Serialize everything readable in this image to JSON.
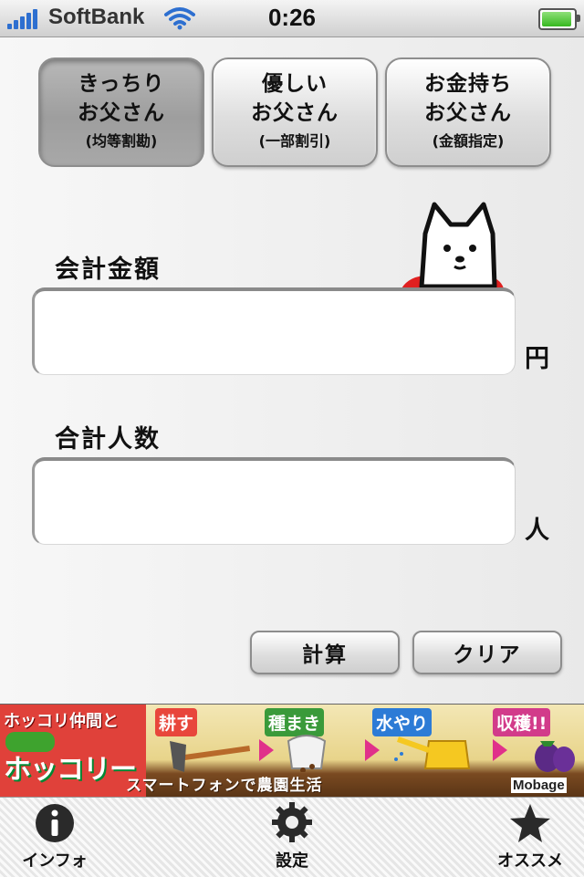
{
  "status_bar": {
    "carrier": "SoftBank",
    "time": "0:26",
    "battery_level": 0.95
  },
  "modes": [
    {
      "line1": "きっちり",
      "line2": "お父さん",
      "sub": "(均等割勘)",
      "selected": true
    },
    {
      "line1": "優しい",
      "line2": "お父さん",
      "sub": "(一部割引)",
      "selected": false
    },
    {
      "line1": "お金持ち",
      "line2": "お父さん",
      "sub": "(金額指定)",
      "selected": false
    }
  ],
  "form": {
    "total_amount_label": "会計金額",
    "total_amount_value": "",
    "total_amount_unit": "円",
    "people_label": "合計人数",
    "people_value": "",
    "people_unit": "人"
  },
  "actions": {
    "calculate": "計算",
    "clear": "クリア"
  },
  "ad": {
    "headline": "ホッコリ仲間と",
    "logo_text": "ホッコリーナ",
    "steps": [
      "耕す",
      "種まき",
      "水やり",
      "収穫!!"
    ],
    "tagline": "スマートフォンで農園生活",
    "brand": "Mobage"
  },
  "tabbar": {
    "items": [
      {
        "label": "インフォ",
        "icon": "info-icon"
      },
      {
        "label": "設定",
        "icon": "gear-icon"
      },
      {
        "label": "オススメ",
        "icon": "star-icon"
      }
    ]
  },
  "colors": {
    "accent_signal": "#2d6fd0",
    "ad_red": "#e0413a",
    "dog_collar": "#e02020"
  }
}
